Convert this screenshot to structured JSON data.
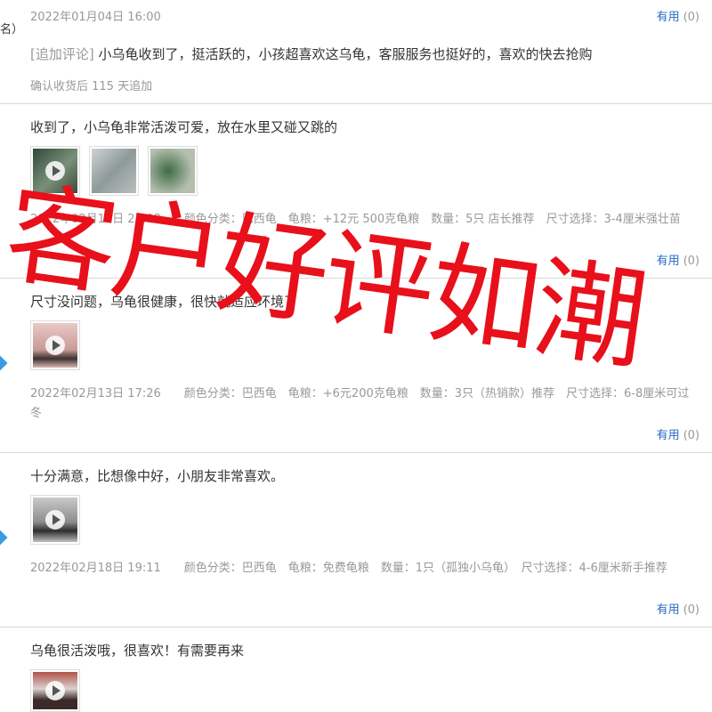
{
  "watermark": "客户好评如潮",
  "left_fragment": "名）",
  "reviews": [
    {
      "date": "2022年01月04日 16:00",
      "useful_label": "有用",
      "useful_count": "(0)",
      "append_tag": "[追加评论]",
      "append_text": "小乌龟收到了，挺活跃的，小孩超喜欢这乌龟，客服服务也挺好的，喜欢的快去抢购",
      "append_days": "确认收货后 115 天追加"
    },
    {
      "text": "收到了，小乌龟非常活泼可爱，放在水里又碰又跳的",
      "meta": "2022年02月14日 23:08　　颜色分类：巴西龟　龟粮：+12元 500克龟粮　数量：5只 店长推荐　尺寸选择：3-4厘米强壮苗",
      "useful_label": "有用",
      "useful_count": "(0)"
    },
    {
      "text": "尺寸没问题，乌龟很健康，很快就适应环境了",
      "meta": "2022年02月13日 17:26　　颜色分类：巴西龟　龟粮：+6元200克龟粮　数量：3只（热销款）推荐　尺寸选择：6-8厘米可过冬",
      "useful_label": "有用",
      "useful_count": "(0)"
    },
    {
      "text": "十分满意，比想像中好，小朋友非常喜欢。",
      "meta": "2022年02月18日 19:11　　颜色分类：巴西龟　龟粮：免费龟粮　数量：1只（孤独小乌龟）　尺寸选择：4-6厘米新手推荐",
      "useful_label": "有用",
      "useful_count": "(0)"
    },
    {
      "text": "乌龟很活泼哦，很喜欢！有需要再来"
    }
  ]
}
